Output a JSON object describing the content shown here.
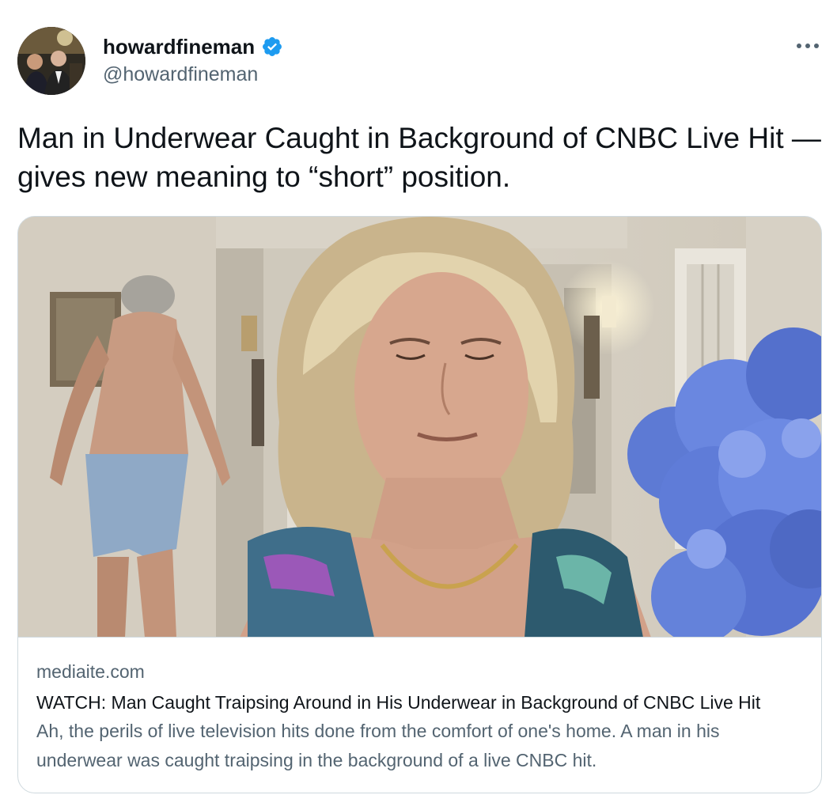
{
  "author": {
    "display_name": "howardfineman",
    "handle": "@howardfineman",
    "verified": true,
    "avatar_icon": "profile-photo"
  },
  "actions": {
    "more_icon": "more-horizontal-icon"
  },
  "tweet": {
    "text": "Man in Underwear Caught in Background of CNBC Live Hit — gives new meaning to “short” position."
  },
  "card": {
    "domain": "mediaite.com",
    "title": "WATCH: Man Caught Traipsing Around in His Underwear in Background of CNBC Live Hit",
    "description": "Ah, the perils of live television hits done from the comfort of one's home. A man in his underwear was caught traipsing in the background of a live CNBC hit."
  },
  "colors": {
    "verified_badge": "#1d9bf0",
    "secondary_text": "#536471",
    "primary_text": "#0f1419",
    "border": "#cfd9de"
  }
}
